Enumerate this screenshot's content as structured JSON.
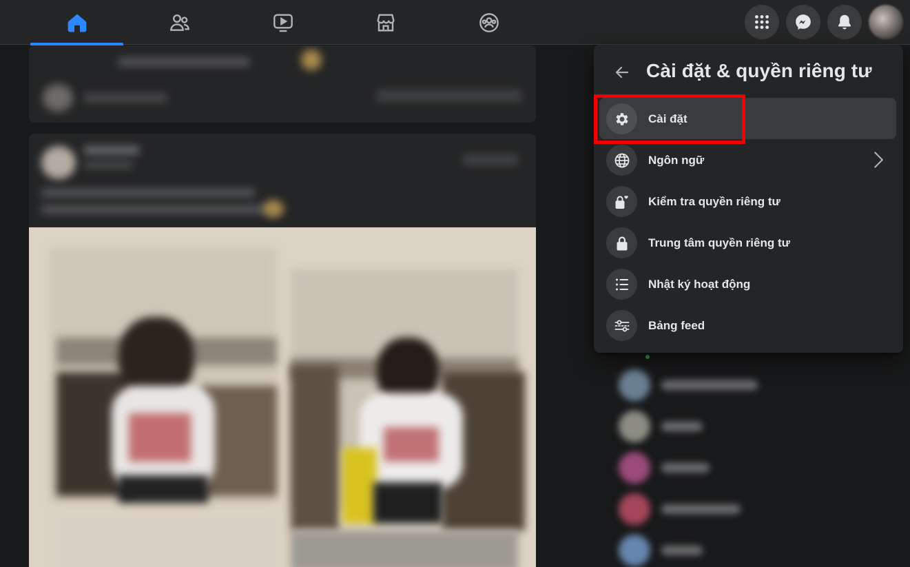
{
  "topbar": {
    "tabs": [
      {
        "name": "home",
        "icon": "home-icon",
        "active": true
      },
      {
        "name": "friends",
        "icon": "friends-icon",
        "active": false
      },
      {
        "name": "watch",
        "icon": "watch-video-icon",
        "active": false
      },
      {
        "name": "marketplace",
        "icon": "marketplace-store-icon",
        "active": false
      },
      {
        "name": "groups",
        "icon": "groups-icon",
        "active": false
      }
    ],
    "right_buttons": [
      "menu-grid-icon",
      "messenger-icon",
      "bell-icon"
    ],
    "accent_color": "#2d88ff"
  },
  "settings_menu": {
    "title": "Cài đặt & quyền riêng tư",
    "items": [
      {
        "label": "Cài đặt",
        "icon": "gear-icon",
        "highlighted": true
      },
      {
        "label": "Ngôn ngữ",
        "icon": "globe-icon",
        "has_submenu": true
      },
      {
        "label": "Kiểm tra quyền riêng tư",
        "icon": "lock-heart-icon"
      },
      {
        "label": "Trung tâm quyền riêng tư",
        "icon": "lock-icon"
      },
      {
        "label": "Nhật ký hoạt động",
        "icon": "list-icon"
      },
      {
        "label": "Bảng feed",
        "icon": "sliders-icon"
      }
    ],
    "highlight_color": "#f00000"
  }
}
